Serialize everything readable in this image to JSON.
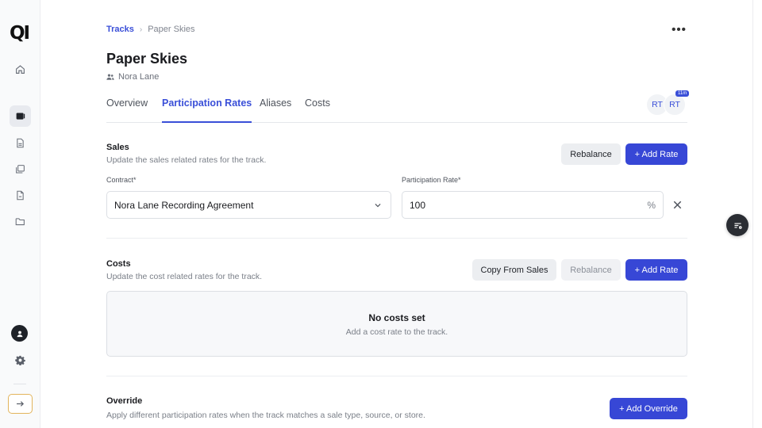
{
  "logo": "QI",
  "colors": {
    "accent": "#3747d6",
    "link": "#3a4fd8",
    "sidebar_bg": "#f9fafb",
    "expand_border": "#e2b45c"
  },
  "sidebar": {
    "items": [
      {
        "icon": "home-icon",
        "active": false
      },
      {
        "icon": "tracks-icon",
        "active": true
      },
      {
        "icon": "document-icon",
        "active": false
      },
      {
        "icon": "stack-icon",
        "active": false
      },
      {
        "icon": "file-icon",
        "active": false
      },
      {
        "icon": "folder-icon",
        "active": false
      }
    ]
  },
  "breadcrumb": {
    "parent": "Tracks",
    "separator": "›",
    "current": "Paper Skies"
  },
  "more_menu": "•••",
  "page": {
    "title": "Paper Skies",
    "owner": "Nora Lane"
  },
  "tabs": [
    {
      "label": "Overview",
      "active": false
    },
    {
      "label": "Participation Rates",
      "active": true
    },
    {
      "label": "Aliases",
      "active": false
    },
    {
      "label": "Costs",
      "active": false
    }
  ],
  "collaborators": {
    "avatars": [
      "RT",
      "RT"
    ],
    "badge": "11m"
  },
  "sales": {
    "title": "Sales",
    "subtitle": "Update the sales related rates for the track.",
    "rebalance_label": "Rebalance",
    "add_rate_label": "+ Add Rate",
    "contract_label": "Contract*",
    "contract_value": "Nora Lane Recording Agreement",
    "rate_label": "Participation Rate*",
    "rate_value": "100",
    "rate_unit": "%"
  },
  "costs": {
    "title": "Costs",
    "subtitle": "Update the cost related rates for the track.",
    "copy_label": "Copy From Sales",
    "rebalance_label": "Rebalance",
    "add_rate_label": "+ Add Rate",
    "empty_title": "No costs set",
    "empty_subtitle": "Add a cost rate to the track."
  },
  "override": {
    "title": "Override",
    "subtitle": "Apply different participation rates when the track matches a sale type, source, or store.",
    "add_label": "+ Add Override"
  }
}
